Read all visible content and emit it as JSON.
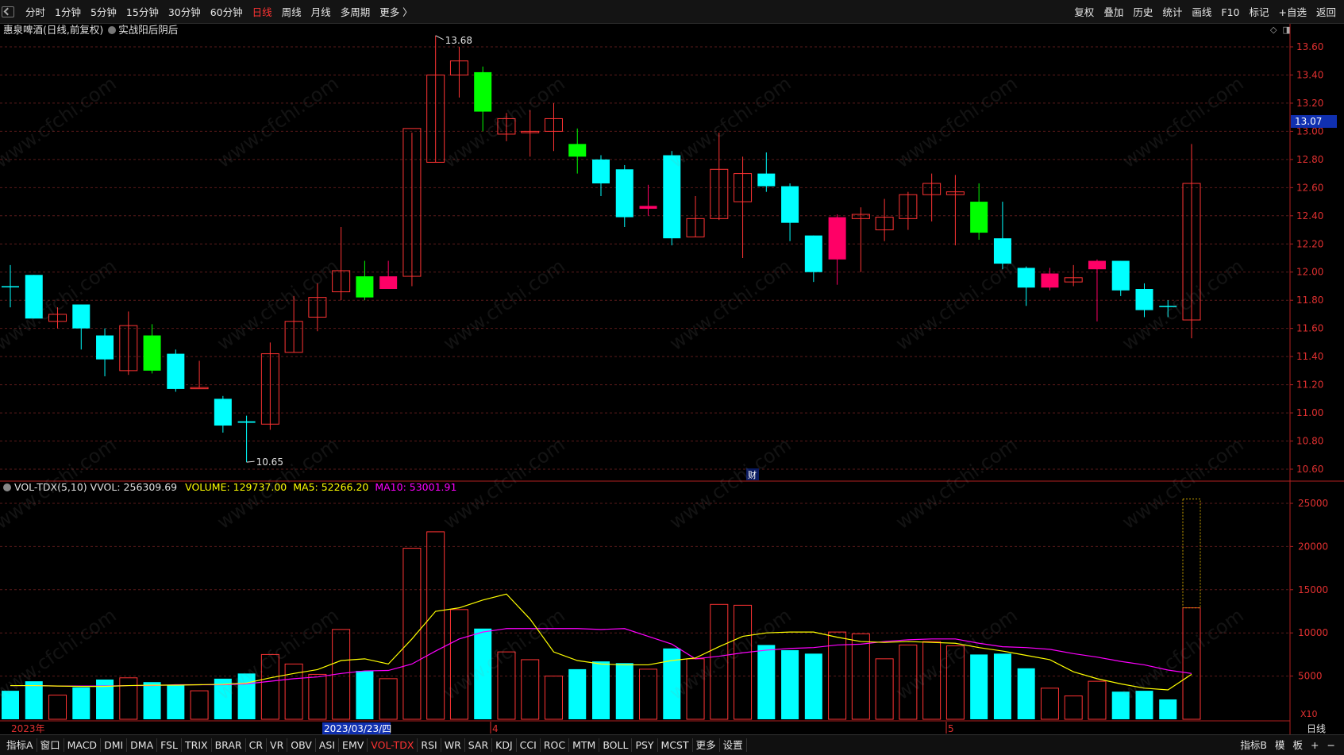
{
  "toolbar": {
    "tabs": [
      "分时",
      "1分钟",
      "5分钟",
      "15分钟",
      "30分钟",
      "60分钟",
      "日线",
      "周线",
      "月线",
      "多周期",
      "更多 〉"
    ],
    "active_tab": "日线",
    "right_tools": [
      "复权",
      "叠加",
      "历史",
      "统计",
      "画线",
      "F10",
      "标记",
      "+自选",
      "返回"
    ]
  },
  "chart_title": {
    "name": "惠泉啤酒(日线,前复权)",
    "indicator": "实战阳后阴后"
  },
  "price_marks": {
    "high": "13.68",
    "low": "10.65",
    "current": "13.07",
    "cai_badge": "财"
  },
  "volume_info": {
    "name": "VOL-TDX(5,10)",
    "vvol": "VVOL: 256309.69",
    "volume": "VOLUME: 129737.00",
    "ma5": "MA5: 52266.20",
    "ma10": "MA10: 53001.91"
  },
  "volume_unit": "X10",
  "date_labels": {
    "year": "2023年",
    "cursor_date": "2023/03/23/四",
    "month4": "4",
    "month5": "5",
    "period": "日线"
  },
  "bottom_tabs": [
    "指标A",
    "窗口",
    "MACD",
    "DMI",
    "DMA",
    "FSL",
    "TRIX",
    "BRAR",
    "CR",
    "VR",
    "OBV",
    "ASI",
    "EMV",
    "VOL-TDX",
    "RSI",
    "WR",
    "SAR",
    "KDJ",
    "CCI",
    "ROC",
    "MTM",
    "BOLL",
    "PSY",
    "MCST",
    "更多",
    "设置"
  ],
  "bottom_active": "VOL-TDX",
  "bottom_right": [
    "指标B",
    "模",
    "板",
    "+",
    "−"
  ],
  "colors": {
    "up": "#ff3333",
    "down": "#00ffff",
    "green": "#00ff00",
    "magenta_candle": "#ff0066",
    "ma5": "#ffff00",
    "ma10": "#ff00ff"
  },
  "chart_data": {
    "type": "candlestick",
    "price_axis": {
      "min": 10.6,
      "max": 13.6,
      "ticks": [
        "13.60",
        "13.40",
        "13.20",
        "13.00",
        "12.80",
        "12.60",
        "12.40",
        "12.20",
        "12.00",
        "11.80",
        "11.60",
        "11.40",
        "11.20",
        "11.00",
        "10.80",
        "10.60"
      ]
    },
    "volume_axis": {
      "min": 0,
      "max": 25000,
      "ticks": [
        "25000",
        "20000",
        "15000",
        "10000",
        "5000"
      ]
    },
    "candles": [
      {
        "o": 11.9,
        "h": 12.05,
        "l": 11.75,
        "c": 11.9,
        "v": 3300,
        "s": "down"
      },
      {
        "o": 11.98,
        "h": 11.98,
        "l": 11.67,
        "c": 11.67,
        "v": 4400,
        "s": "down"
      },
      {
        "o": 11.65,
        "h": 11.75,
        "l": 11.6,
        "c": 11.7,
        "v": 2800,
        "s": "up"
      },
      {
        "o": 11.77,
        "h": 11.77,
        "l": 11.45,
        "c": 11.6,
        "v": 3700,
        "s": "down"
      },
      {
        "o": 11.55,
        "h": 11.6,
        "l": 11.26,
        "c": 11.38,
        "v": 4600,
        "s": "down"
      },
      {
        "o": 11.3,
        "h": 11.72,
        "l": 11.27,
        "c": 11.62,
        "v": 4800,
        "s": "up"
      },
      {
        "o": 11.55,
        "h": 11.63,
        "l": 11.28,
        "c": 11.3,
        "v": 4300,
        "s": "green"
      },
      {
        "o": 11.42,
        "h": 11.45,
        "l": 11.15,
        "c": 11.17,
        "v": 4000,
        "s": "down"
      },
      {
        "o": 11.18,
        "h": 11.37,
        "l": 11.18,
        "c": 11.18,
        "v": 3300,
        "s": "up"
      },
      {
        "o": 11.1,
        "h": 11.12,
        "l": 10.86,
        "c": 10.91,
        "v": 4700,
        "s": "down"
      },
      {
        "o": 10.94,
        "h": 10.98,
        "l": 10.65,
        "c": 10.93,
        "v": 5300,
        "s": "down"
      },
      {
        "o": 10.92,
        "h": 11.5,
        "l": 10.88,
        "c": 11.42,
        "v": 7500,
        "s": "up"
      },
      {
        "o": 11.43,
        "h": 11.83,
        "l": 11.43,
        "c": 11.65,
        "v": 6400,
        "s": "up"
      },
      {
        "o": 11.68,
        "h": 11.92,
        "l": 11.58,
        "c": 11.82,
        "v": 5200,
        "s": "up"
      },
      {
        "o": 11.86,
        "h": 12.32,
        "l": 11.8,
        "c": 12.01,
        "v": 10400,
        "s": "up"
      },
      {
        "o": 11.97,
        "h": 12.08,
        "l": 11.8,
        "c": 11.82,
        "v": 5600,
        "s": "green"
      },
      {
        "o": 11.88,
        "h": 12.08,
        "l": 11.88,
        "c": 11.97,
        "v": 4700,
        "s": "magenta"
      },
      {
        "o": 11.97,
        "h": 12.99,
        "l": 11.9,
        "c": 13.02,
        "v": 19800,
        "s": "up"
      },
      {
        "o": 12.78,
        "h": 13.68,
        "l": 12.78,
        "c": 13.4,
        "v": 21700,
        "s": "up"
      },
      {
        "o": 13.4,
        "h": 13.6,
        "l": 13.24,
        "c": 13.5,
        "v": 12700,
        "s": "up"
      },
      {
        "o": 13.42,
        "h": 13.46,
        "l": 13.0,
        "c": 13.14,
        "v": 10500,
        "s": "green"
      },
      {
        "o": 12.98,
        "h": 13.13,
        "l": 12.93,
        "c": 13.09,
        "v": 7800,
        "s": "up"
      },
      {
        "o": 12.99,
        "h": 13.15,
        "l": 12.82,
        "c": 13.0,
        "v": 6900,
        "s": "up"
      },
      {
        "o": 13.0,
        "h": 13.2,
        "l": 12.86,
        "c": 13.09,
        "v": 5000,
        "s": "up"
      },
      {
        "o": 12.91,
        "h": 13.02,
        "l": 12.7,
        "c": 12.82,
        "v": 5800,
        "s": "green"
      },
      {
        "o": 12.8,
        "h": 12.83,
        "l": 12.54,
        "c": 12.63,
        "v": 6700,
        "s": "down"
      },
      {
        "o": 12.73,
        "h": 12.76,
        "l": 12.32,
        "c": 12.39,
        "v": 6500,
        "s": "down"
      },
      {
        "o": 12.47,
        "h": 12.62,
        "l": 12.4,
        "c": 12.45,
        "v": 5800,
        "s": "magenta"
      },
      {
        "o": 12.83,
        "h": 12.86,
        "l": 12.19,
        "c": 12.24,
        "v": 8200,
        "s": "down"
      },
      {
        "o": 12.25,
        "h": 12.54,
        "l": 12.25,
        "c": 12.38,
        "v": 7000,
        "s": "up"
      },
      {
        "o": 12.38,
        "h": 12.99,
        "l": 12.37,
        "c": 12.73,
        "v": 13300,
        "s": "up"
      },
      {
        "o": 12.5,
        "h": 12.82,
        "l": 12.1,
        "c": 12.7,
        "v": 13200,
        "s": "up"
      },
      {
        "o": 12.7,
        "h": 12.85,
        "l": 12.57,
        "c": 12.61,
        "v": 8600,
        "s": "down"
      },
      {
        "o": 12.61,
        "h": 12.63,
        "l": 12.22,
        "c": 12.35,
        "v": 8000,
        "s": "down"
      },
      {
        "o": 12.26,
        "h": 12.26,
        "l": 11.93,
        "c": 12.0,
        "v": 7600,
        "s": "down"
      },
      {
        "o": 12.39,
        "h": 12.41,
        "l": 11.91,
        "c": 12.09,
        "v": 10100,
        "s": "magenta"
      },
      {
        "o": 12.41,
        "h": 12.46,
        "l": 12.0,
        "c": 12.38,
        "v": 9900,
        "s": "up"
      },
      {
        "o": 12.3,
        "h": 12.52,
        "l": 12.22,
        "c": 12.39,
        "v": 7000,
        "s": "up"
      },
      {
        "o": 12.38,
        "h": 12.57,
        "l": 12.3,
        "c": 12.55,
        "v": 8600,
        "s": "up"
      },
      {
        "o": 12.55,
        "h": 12.7,
        "l": 12.36,
        "c": 12.63,
        "v": 9000,
        "s": "up"
      },
      {
        "o": 12.55,
        "h": 12.69,
        "l": 12.19,
        "c": 12.57,
        "v": 8500,
        "s": "up"
      },
      {
        "o": 12.5,
        "h": 12.63,
        "l": 12.23,
        "c": 12.28,
        "v": 7500,
        "s": "green"
      },
      {
        "o": 12.24,
        "h": 12.5,
        "l": 12.02,
        "c": 12.06,
        "v": 7600,
        "s": "down"
      },
      {
        "o": 12.03,
        "h": 12.04,
        "l": 11.76,
        "c": 11.89,
        "v": 5900,
        "s": "down"
      },
      {
        "o": 11.99,
        "h": 12.03,
        "l": 11.87,
        "c": 11.89,
        "v": 3600,
        "s": "magenta"
      },
      {
        "o": 11.93,
        "h": 12.05,
        "l": 11.9,
        "c": 11.96,
        "v": 2700,
        "s": "up"
      },
      {
        "o": 12.02,
        "h": 12.09,
        "l": 11.65,
        "c": 12.08,
        "v": 4400,
        "s": "magenta"
      },
      {
        "o": 12.08,
        "h": 12.08,
        "l": 11.83,
        "c": 11.87,
        "v": 3200,
        "s": "down"
      },
      {
        "o": 11.88,
        "h": 11.92,
        "l": 11.68,
        "c": 11.73,
        "v": 3300,
        "s": "down"
      },
      {
        "o": 11.76,
        "h": 11.8,
        "l": 11.68,
        "c": 11.76,
        "v": 2300,
        "s": "down"
      },
      {
        "o": 11.66,
        "h": 12.91,
        "l": 11.53,
        "c": 12.63,
        "v": 12900,
        "s": "up",
        "vmax": 25500
      }
    ],
    "ma5": [
      3900,
      3900,
      3850,
      3800,
      3800,
      3900,
      3950,
      3950,
      4000,
      4050,
      4200,
      4800,
      5300,
      5750,
      6800,
      7000,
      6400,
      9300,
      12500,
      12900,
      13800,
      14500,
      11600,
      7800,
      6800,
      6400,
      6300,
      6300,
      6800,
      7100,
      8400,
      9600,
      10000,
      10100,
      10100,
      9500,
      9000,
      8900,
      9000,
      8900,
      8800,
      8300,
      7900,
      7400,
      6900,
      5500,
      4700,
      4100,
      3600,
      3400,
      5200
    ],
    "ma10": [
      3900,
      3900,
      3850,
      3850,
      3850,
      3900,
      3900,
      4000,
      4000,
      4000,
      4100,
      4400,
      4700,
      4900,
      5300,
      5600,
      5650,
      6400,
      7900,
      9300,
      10100,
      10500,
      10500,
      10500,
      10500,
      10400,
      10500,
      9600,
      8700,
      7000,
      7300,
      7700,
      8000,
      8200,
      8300,
      8600,
      8700,
      9000,
      9200,
      9300,
      9300,
      8800,
      8400,
      8300,
      8100,
      7600,
      7200,
      6700,
      6300,
      5700,
      5300
    ]
  }
}
